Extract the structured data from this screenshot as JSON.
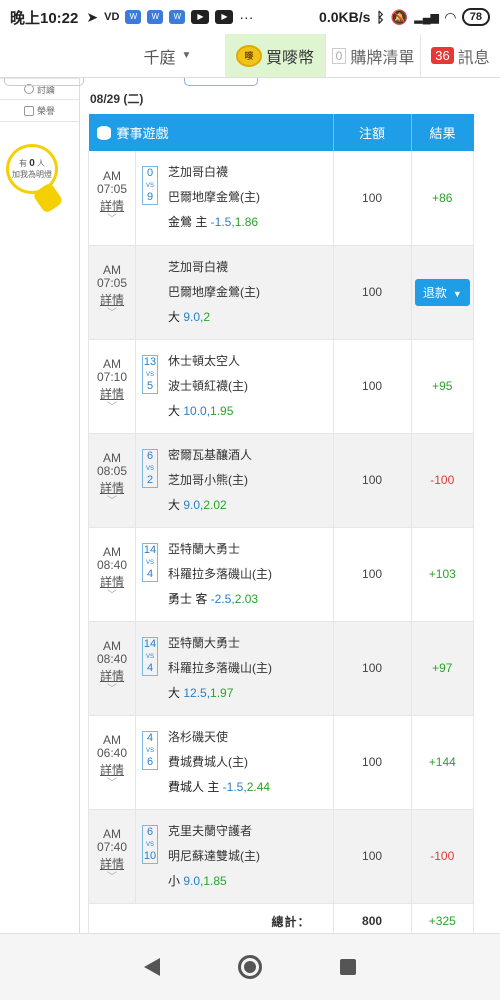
{
  "status_bar": {
    "time": "晚上10:22",
    "indicators": [
      "telegram-icon",
      "VD",
      "Word",
      "Word",
      "Word",
      "youtube-icon",
      "youtube-icon",
      "..."
    ],
    "net_speed": "0.0KB/s",
    "battery": "78"
  },
  "topnav": {
    "site": "千庭",
    "buy_coin": "買嘜幣",
    "coin_badge": "嘜",
    "card_count": "0",
    "card_label": "購牌清單",
    "msg_count": "36",
    "msg_label": "訊息"
  },
  "sidebar": {
    "items": [
      {
        "label": "討論",
        "icon": "discussion-icon"
      },
      {
        "label": "榮譽",
        "icon": "honor-icon"
      }
    ],
    "bulb_line1_pre": "有",
    "bulb_count": "0",
    "bulb_line1_post": "人",
    "bulb_line2": "加我為明燈"
  },
  "date": "08/29 (二)",
  "table": {
    "headers": {
      "game": "賽事遊戲",
      "amount": "注額",
      "result": "結果"
    },
    "rows": [
      {
        "ampm": "AM",
        "time": "07:05",
        "detail": "詳情",
        "score_a": "0",
        "score_b": "9",
        "team_a": "芝加哥白襪",
        "team_b": "巴爾地摩金鶯(主)",
        "bet_text": "金鶯 主 ",
        "bet_num": "-1.5",
        "bet_sep": ",",
        "bet_odd": "1.86",
        "amount": "100",
        "result": "+86",
        "result_type": "win"
      },
      {
        "ampm": "AM",
        "time": "07:05",
        "detail": "詳情",
        "score_a": "",
        "score_b": "",
        "team_a": "芝加哥白襪",
        "team_b": "巴爾地摩金鶯(主)",
        "bet_text": "大 ",
        "bet_num": "9.0",
        "bet_sep": ",",
        "bet_odd": "2",
        "amount": "100",
        "result": "退款",
        "result_type": "refund"
      },
      {
        "ampm": "AM",
        "time": "07:10",
        "detail": "詳情",
        "score_a": "13",
        "score_b": "5",
        "team_a": "休士頓太空人",
        "team_b": "波士頓紅襪(主)",
        "bet_text": "大 ",
        "bet_num": "10.0",
        "bet_sep": ",",
        "bet_odd": "1.95",
        "amount": "100",
        "result": "+95",
        "result_type": "win"
      },
      {
        "ampm": "AM",
        "time": "08:05",
        "detail": "詳情",
        "score_a": "6",
        "score_b": "2",
        "team_a": "密爾瓦基釀酒人",
        "team_b": "芝加哥小熊(主)",
        "bet_text": "大 ",
        "bet_num": "9.0",
        "bet_sep": ",",
        "bet_odd": "2.02",
        "amount": "100",
        "result": "-100",
        "result_type": "lose"
      },
      {
        "ampm": "AM",
        "time": "08:40",
        "detail": "詳情",
        "score_a": "14",
        "score_b": "4",
        "team_a": "亞特蘭大勇士",
        "team_b": "科羅拉多落磯山(主)",
        "bet_text": "勇士 客 ",
        "bet_num": "-2.5",
        "bet_sep": ",",
        "bet_odd": "2.03",
        "amount": "100",
        "result": "+103",
        "result_type": "win"
      },
      {
        "ampm": "AM",
        "time": "08:40",
        "detail": "詳情",
        "score_a": "14",
        "score_b": "4",
        "team_a": "亞特蘭大勇士",
        "team_b": "科羅拉多落磯山(主)",
        "bet_text": "大 ",
        "bet_num": "12.5",
        "bet_sep": ",",
        "bet_odd": "1.97",
        "amount": "100",
        "result": "+97",
        "result_type": "win"
      },
      {
        "ampm": "AM",
        "time": "06:40",
        "detail": "詳情",
        "score_a": "4",
        "score_b": "6",
        "team_a": "洛杉磯天使",
        "team_b": "費城費城人(主)",
        "bet_text": "費城人 主 ",
        "bet_num": "-1.5",
        "bet_sep": ",",
        "bet_odd": "2.44",
        "amount": "100",
        "result": "+144",
        "result_type": "win"
      },
      {
        "ampm": "AM",
        "time": "07:40",
        "detail": "詳情",
        "score_a": "6",
        "score_b": "10",
        "team_a": "克里夫蘭守護者",
        "team_b": "明尼蘇達雙城(主)",
        "bet_text": "小 ",
        "bet_num": "9.0",
        "bet_sep": ",",
        "bet_odd": "1.85",
        "amount": "100",
        "result": "-100",
        "result_type": "lose"
      }
    ],
    "total_label": "總計：",
    "total_amount": "800",
    "total_result": "+325"
  },
  "colors": {
    "header_blue": "#1f9de6",
    "win_green": "#28a428",
    "lose_red": "#e53935",
    "link_blue": "#2a7fc6"
  }
}
